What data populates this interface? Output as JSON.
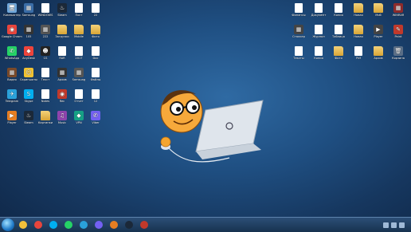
{
  "desktop": {
    "icons": [
      {
        "label": "Компьютер",
        "glyph": "🖥",
        "color": "#6fa8dc",
        "kind": "app"
      },
      {
        "label": "Samsung",
        "glyph": "▦",
        "color": "#3b6ea8",
        "kind": "app"
      },
      {
        "label": "WINDOWS",
        "glyph": "",
        "color": "",
        "kind": "doc"
      },
      {
        "label": "Steam",
        "glyph": "♨",
        "color": "#1b2838",
        "kind": "app"
      },
      {
        "label": "Пост",
        "glyph": "",
        "color": "",
        "kind": "doc"
      },
      {
        "label": "22",
        "glyph": "",
        "color": "",
        "kind": "doc"
      },
      {
        "label": "Google Chrome",
        "glyph": "◉",
        "color": "#e8453c",
        "kind": "app"
      },
      {
        "label": "105",
        "glyph": "▦",
        "color": "#333",
        "kind": "app"
      },
      {
        "label": "222",
        "glyph": "▦",
        "color": "#555",
        "kind": "app"
      },
      {
        "label": "Загрузки",
        "glyph": "",
        "color": "",
        "kind": "folder"
      },
      {
        "label": "Mobile",
        "glyph": "",
        "color": "",
        "kind": "folder"
      },
      {
        "label": "Фото",
        "glyph": "",
        "color": "",
        "kind": "folder"
      },
      {
        "label": "WhatsApp",
        "glyph": "✆",
        "color": "#25d366",
        "kind": "app"
      },
      {
        "label": "AnyDesk",
        "glyph": "◆",
        "color": "#ef443b",
        "kind": "app"
      },
      {
        "label": "CS",
        "glyph": "☻",
        "color": "#222",
        "kind": "app"
      },
      {
        "label": "RAR",
        "glyph": "",
        "color": "",
        "kind": "doc"
      },
      {
        "label": "2017",
        "glyph": "",
        "color": "",
        "kind": "doc"
      },
      {
        "label": "Doc",
        "glyph": "",
        "color": "",
        "kind": "doc"
      },
      {
        "label": "Видео",
        "glyph": "▦",
        "color": "#7a4a2a",
        "kind": "app"
      },
      {
        "label": "Скриншоты",
        "glyph": "☺",
        "color": "#f1c232",
        "kind": "app"
      },
      {
        "label": "Текст",
        "glyph": "",
        "color": "",
        "kind": "doc"
      },
      {
        "label": "Архив",
        "glyph": "▦",
        "color": "#333",
        "kind": "app"
      },
      {
        "label": "Samsung",
        "glyph": "▦",
        "color": "#555",
        "kind": "app"
      },
      {
        "label": "Файлы",
        "glyph": "",
        "color": "",
        "kind": "doc"
      },
      {
        "label": "Telegram",
        "glyph": "✈",
        "color": "#2aa1da",
        "kind": "app"
      },
      {
        "label": "Skype",
        "glyph": "S",
        "color": "#00aff0",
        "kind": "app"
      },
      {
        "label": "Notes",
        "glyph": "",
        "color": "",
        "kind": "doc"
      },
      {
        "label": "Rec",
        "glyph": "◉",
        "color": "#c0392b",
        "kind": "app"
      },
      {
        "label": "Отчет",
        "glyph": "",
        "color": "",
        "kind": "doc"
      },
      {
        "label": "12",
        "glyph": "",
        "color": "",
        "kind": "doc"
      },
      {
        "label": "Player",
        "glyph": "▶",
        "color": "#e67e22",
        "kind": "app"
      },
      {
        "label": "Steam",
        "glyph": "♨",
        "color": "#1b2838",
        "kind": "app"
      },
      {
        "label": "Картинки",
        "glyph": "",
        "color": "",
        "kind": "folder"
      },
      {
        "label": "Music",
        "glyph": "♫",
        "color": "#8e44ad",
        "kind": "app"
      },
      {
        "label": "VPN",
        "glyph": "◆",
        "color": "#16a085",
        "kind": "app"
      },
      {
        "label": "Viber",
        "glyph": "✆",
        "color": "#7360f2",
        "kind": "app"
      }
    ],
    "right_icons": [
      {
        "label": "Финансы",
        "glyph": "",
        "color": "",
        "kind": "doc"
      },
      {
        "label": "Документ",
        "glyph": "",
        "color": "",
        "kind": "doc"
      },
      {
        "label": "Копия",
        "glyph": "",
        "color": "",
        "kind": "doc"
      },
      {
        "label": "Новая",
        "glyph": "",
        "color": "",
        "kind": "folder"
      },
      {
        "label": "Моб",
        "glyph": "",
        "color": "",
        "kind": "folder"
      },
      {
        "label": "WINRAR",
        "glyph": "▦",
        "color": "#8e2b2b",
        "kind": "app"
      },
      {
        "label": "Сталкер",
        "glyph": "▦",
        "color": "#444",
        "kind": "app"
      },
      {
        "label": "Журнал",
        "glyph": "",
        "color": "",
        "kind": "doc"
      },
      {
        "label": "Таблица",
        "glyph": "",
        "color": "",
        "kind": "doc"
      },
      {
        "label": "Новая",
        "glyph": "",
        "color": "",
        "kind": "folder"
      },
      {
        "label": "Player",
        "glyph": "▶",
        "color": "#444",
        "kind": "app"
      },
      {
        "label": "Paint",
        "glyph": "✎",
        "color": "#c0392b",
        "kind": "app"
      },
      {
        "label": "Тексты",
        "glyph": "",
        "color": "",
        "kind": "doc"
      },
      {
        "label": "Копия",
        "glyph": "",
        "color": "",
        "kind": "doc"
      },
      {
        "label": "Фото",
        "glyph": "",
        "color": "",
        "kind": "folder"
      },
      {
        "label": "Pdf",
        "glyph": "",
        "color": "",
        "kind": "doc"
      },
      {
        "label": "Архив",
        "glyph": "",
        "color": "",
        "kind": "folder"
      },
      {
        "label": "Корзина",
        "glyph": "🗑",
        "color": "#5a6e86",
        "kind": "app"
      }
    ]
  },
  "taskbar": {
    "apps": [
      {
        "name": "explorer",
        "color": "#f3c13a"
      },
      {
        "name": "chrome",
        "color": "#e8453c"
      },
      {
        "name": "skype",
        "color": "#00aff0"
      },
      {
        "name": "whatsapp",
        "color": "#25d366"
      },
      {
        "name": "telegram",
        "color": "#2aa1da"
      },
      {
        "name": "viber",
        "color": "#7360f2"
      },
      {
        "name": "player",
        "color": "#e67e22"
      },
      {
        "name": "steam",
        "color": "#1b2838"
      },
      {
        "name": "paint",
        "color": "#c0392b"
      }
    ],
    "mini_bar_label": "Запись",
    "clock_time": "",
    "clock_date": ""
  }
}
